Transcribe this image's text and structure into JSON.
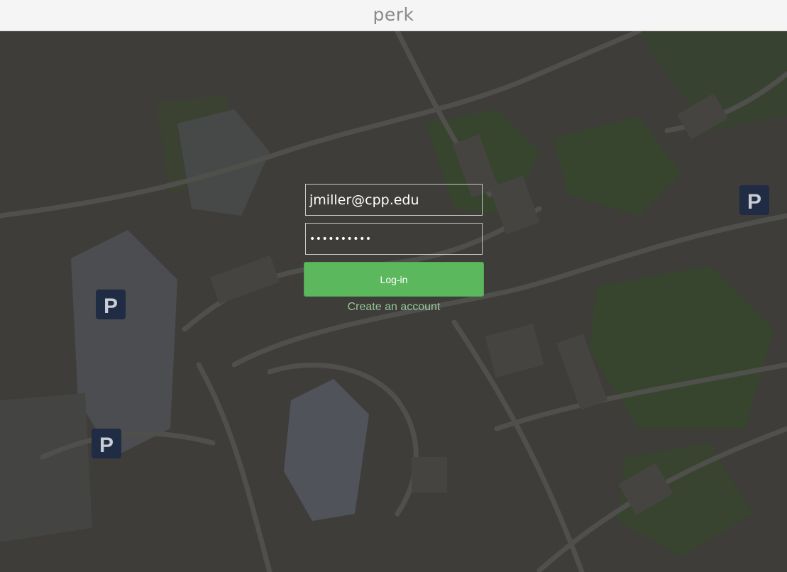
{
  "header": {
    "brand": "perk"
  },
  "login": {
    "email_value": "jmiller@cpp.edu",
    "password_mask": "••••••••••",
    "login_label": "Log-in",
    "create_account_label": "Create an account"
  },
  "map": {
    "marker_icon": "parking-icon",
    "marker_glyph": "P",
    "colors": {
      "overlay": "#3b3b39",
      "green": "#37452e",
      "road": "#4f4f4b",
      "water": "#50545a",
      "marker": "#1f2c44"
    }
  },
  "colors": {
    "accent": "#5cb85c",
    "link": "#93c793",
    "header_bg": "#f5f5f5"
  }
}
